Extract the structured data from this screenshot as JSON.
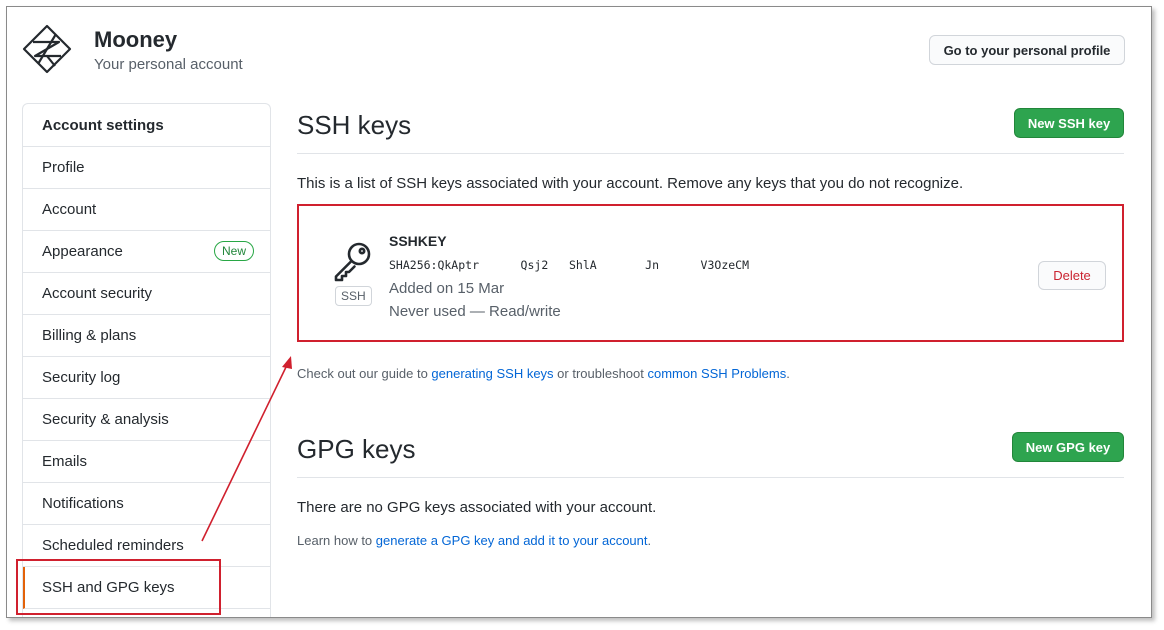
{
  "header": {
    "user_name": "Mooney",
    "user_subtitle": "Your personal account",
    "profile_button": "Go to your personal profile"
  },
  "sidebar": {
    "heading": "Account settings",
    "items": [
      {
        "label": "Profile"
      },
      {
        "label": "Account"
      },
      {
        "label": "Appearance",
        "badge": "New"
      },
      {
        "label": "Account security"
      },
      {
        "label": "Billing & plans"
      },
      {
        "label": "Security log"
      },
      {
        "label": "Security & analysis"
      },
      {
        "label": "Emails"
      },
      {
        "label": "Notifications"
      },
      {
        "label": "Scheduled reminders"
      },
      {
        "label": "SSH and GPG keys",
        "selected": true
      }
    ]
  },
  "ssh": {
    "title": "SSH keys",
    "new_button": "New SSH key",
    "description": "This is a list of SSH keys associated with your account. Remove any keys that you do not recognize.",
    "key": {
      "type_label": "SSH",
      "name": "SSHKEY",
      "fingerprint": "SHA256:QkAptr      Qsj2   ShlA       Jn      V3OzeCM",
      "added": "Added on 15 Mar",
      "usage": "Never used — Read/write",
      "delete_button": "Delete"
    },
    "guide_prefix": "Check out our guide to ",
    "guide_link1": "generating SSH keys",
    "guide_middle": " or troubleshoot ",
    "guide_link2": "common SSH Problems",
    "guide_suffix": "."
  },
  "gpg": {
    "title": "GPG keys",
    "new_button": "New GPG key",
    "empty_text": "There are no GPG keys associated with your account.",
    "learn_prefix": "Learn how to ",
    "learn_link": "generate a GPG key and add it to your account",
    "learn_suffix": "."
  },
  "colors": {
    "accent_green": "#2ea44f",
    "link_blue": "#0366d6",
    "annotation_red": "#d0202e",
    "selected_marker": "#e36209"
  }
}
